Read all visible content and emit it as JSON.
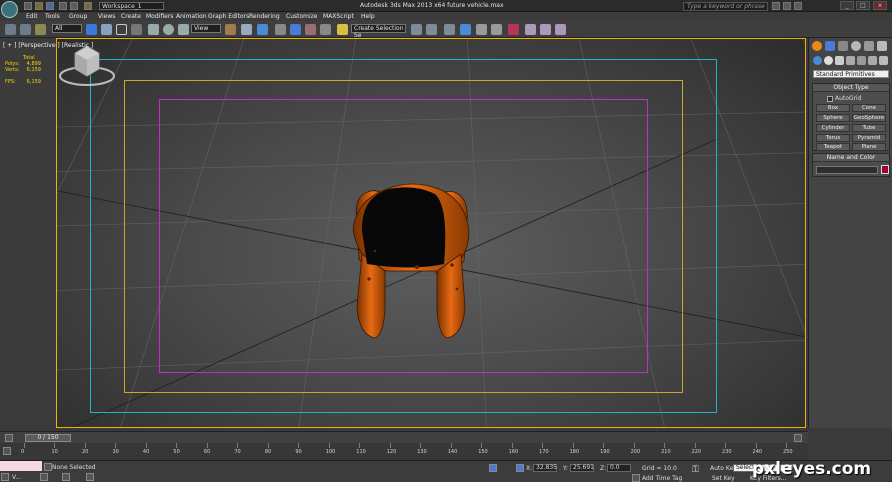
{
  "window": {
    "title": "Autodesk 3ds Max  2013 x64     future vehicle.max",
    "workspace": "Workspace_1",
    "search_placeholder": "Type a keyword or phrase"
  },
  "menu": [
    "Edit",
    "Tools",
    "Group",
    "Views",
    "Create",
    "Modifiers",
    "Animation",
    "Graph Editors",
    "Rendering",
    "Customize",
    "MAXScript",
    "Help"
  ],
  "toolbar": {
    "selection_filter": "All",
    "ref_coord": "View",
    "named_selection": "Create Selection Se"
  },
  "viewport": {
    "label": "[ + ] [Perspective ] [Realistic ]",
    "stats": {
      "header": "Total",
      "polys_label": "Polys:",
      "polys_value": "4,899",
      "verts_label": "Verts:",
      "verts_value": "6,159",
      "fps_label": "FPS:",
      "fps_value": "6,159"
    }
  },
  "command_panel": {
    "primitive_type": "Standard Primitives",
    "object_type": {
      "title": "Object Type",
      "autogrid": "AutoGrid",
      "buttons": [
        "Box",
        "Cone",
        "Sphere",
        "GeoSphere",
        "Cylinder",
        "Tube",
        "Torus",
        "Pyramid",
        "Teapot",
        "Plane"
      ]
    },
    "name_color": {
      "title": "Name and Color",
      "swatch_color": "#a4002c"
    }
  },
  "timeline": {
    "slider": "0 / 150",
    "ticks": [
      "0",
      "10",
      "20",
      "30",
      "40",
      "50",
      "60",
      "70",
      "80",
      "90",
      "100",
      "110",
      "120",
      "130",
      "140",
      "150",
      "160",
      "170",
      "180",
      "190",
      "200",
      "210",
      "220",
      "230",
      "240",
      "250"
    ]
  },
  "status": {
    "listener_text": "V...",
    "selection": "None Selected",
    "x_label": "X:",
    "x_value": "32.835",
    "y_label": "Y:",
    "y_value": "25.691",
    "z_label": "Z:",
    "z_value": "0.0",
    "grid": "Grid = 10.0",
    "add_time_tag": "Add Time Tag",
    "auto_key": "Auto Key",
    "set_key": "Set Key",
    "key_mode": "Selected",
    "key_filters": "Key Filters..."
  },
  "watermark": "pxleyes.com"
}
